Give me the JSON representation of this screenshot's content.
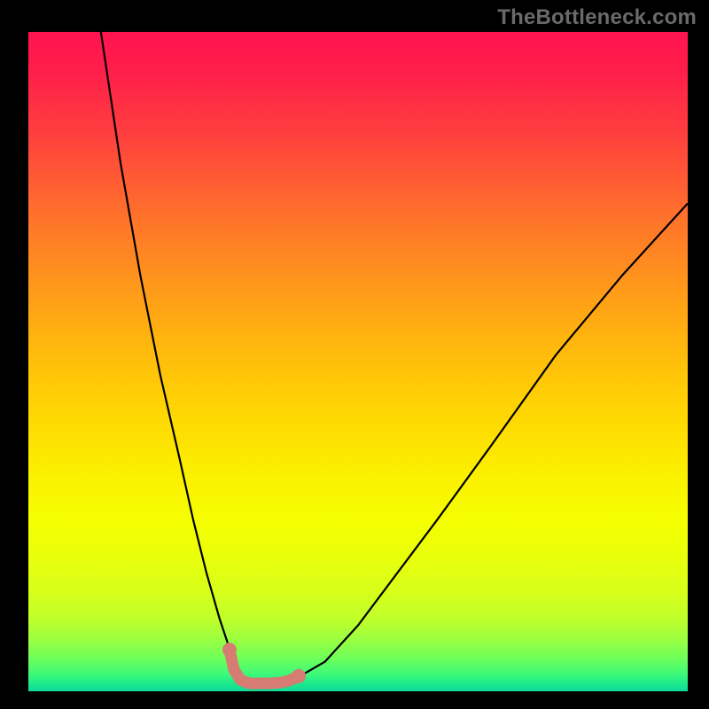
{
  "watermark_text": "TheBottleneck.com",
  "chart_data": {
    "type": "line",
    "title": "",
    "xlabel": "",
    "ylabel": "",
    "xlim": [
      0,
      100
    ],
    "ylim": [
      0,
      100
    ],
    "axes_visible": false,
    "tick_labels": [],
    "legend": false,
    "background_gradient": {
      "direction": "vertical",
      "stops": [
        {
          "pos": 0.0,
          "color": "#ff1450"
        },
        {
          "pos": 0.15,
          "color": "#ff3d3f"
        },
        {
          "pos": 0.36,
          "color": "#ff8f1f"
        },
        {
          "pos": 0.56,
          "color": "#ffd104"
        },
        {
          "pos": 0.74,
          "color": "#f6ff00"
        },
        {
          "pos": 0.89,
          "color": "#c0ff2a"
        },
        {
          "pos": 0.97,
          "color": "#3cf97a"
        },
        {
          "pos": 1.0,
          "color": "#0fd99a"
        }
      ]
    },
    "series": [
      {
        "name": "bottleneck-curve",
        "stroke": "#000000",
        "x": [
          11,
          14,
          17,
          20,
          23,
          25,
          27,
          29,
          30.5,
          32,
          33.2,
          35,
          37,
          40,
          45,
          50,
          56,
          62,
          70,
          80,
          90,
          100
        ],
        "y": [
          100,
          80,
          63,
          48,
          35,
          26,
          18,
          11,
          6.5,
          3.2,
          1.5,
          1.2,
          1.2,
          1.6,
          4.5,
          10,
          18,
          26,
          37,
          51,
          63,
          74
        ]
      },
      {
        "name": "optimal-zone-marker",
        "stroke": "#d67c72",
        "thick": true,
        "x": [
          30.5,
          31.2,
          32.2,
          33.5,
          35,
          36.5,
          38,
          39.5,
          41
        ],
        "y": [
          6.3,
          3.2,
          1.7,
          1.2,
          1.2,
          1.2,
          1.3,
          1.6,
          2.3
        ],
        "endpoints": [
          {
            "x": 30.5,
            "y": 6.3,
            "r": 1.0
          },
          {
            "x": 41.0,
            "y": 2.3,
            "r": 1.0
          }
        ]
      }
    ],
    "notes": "No numeric axis ticks are drawn in the source; x and y are normalized 0–100. Low y = good (green), high y = bad (red). The thick pink segment marks the flat minimum of the black curve."
  },
  "frame": {
    "border_color": "#000000",
    "inner_left": 32,
    "inner_top": 36,
    "inner_right": 24,
    "inner_bottom": 20
  }
}
